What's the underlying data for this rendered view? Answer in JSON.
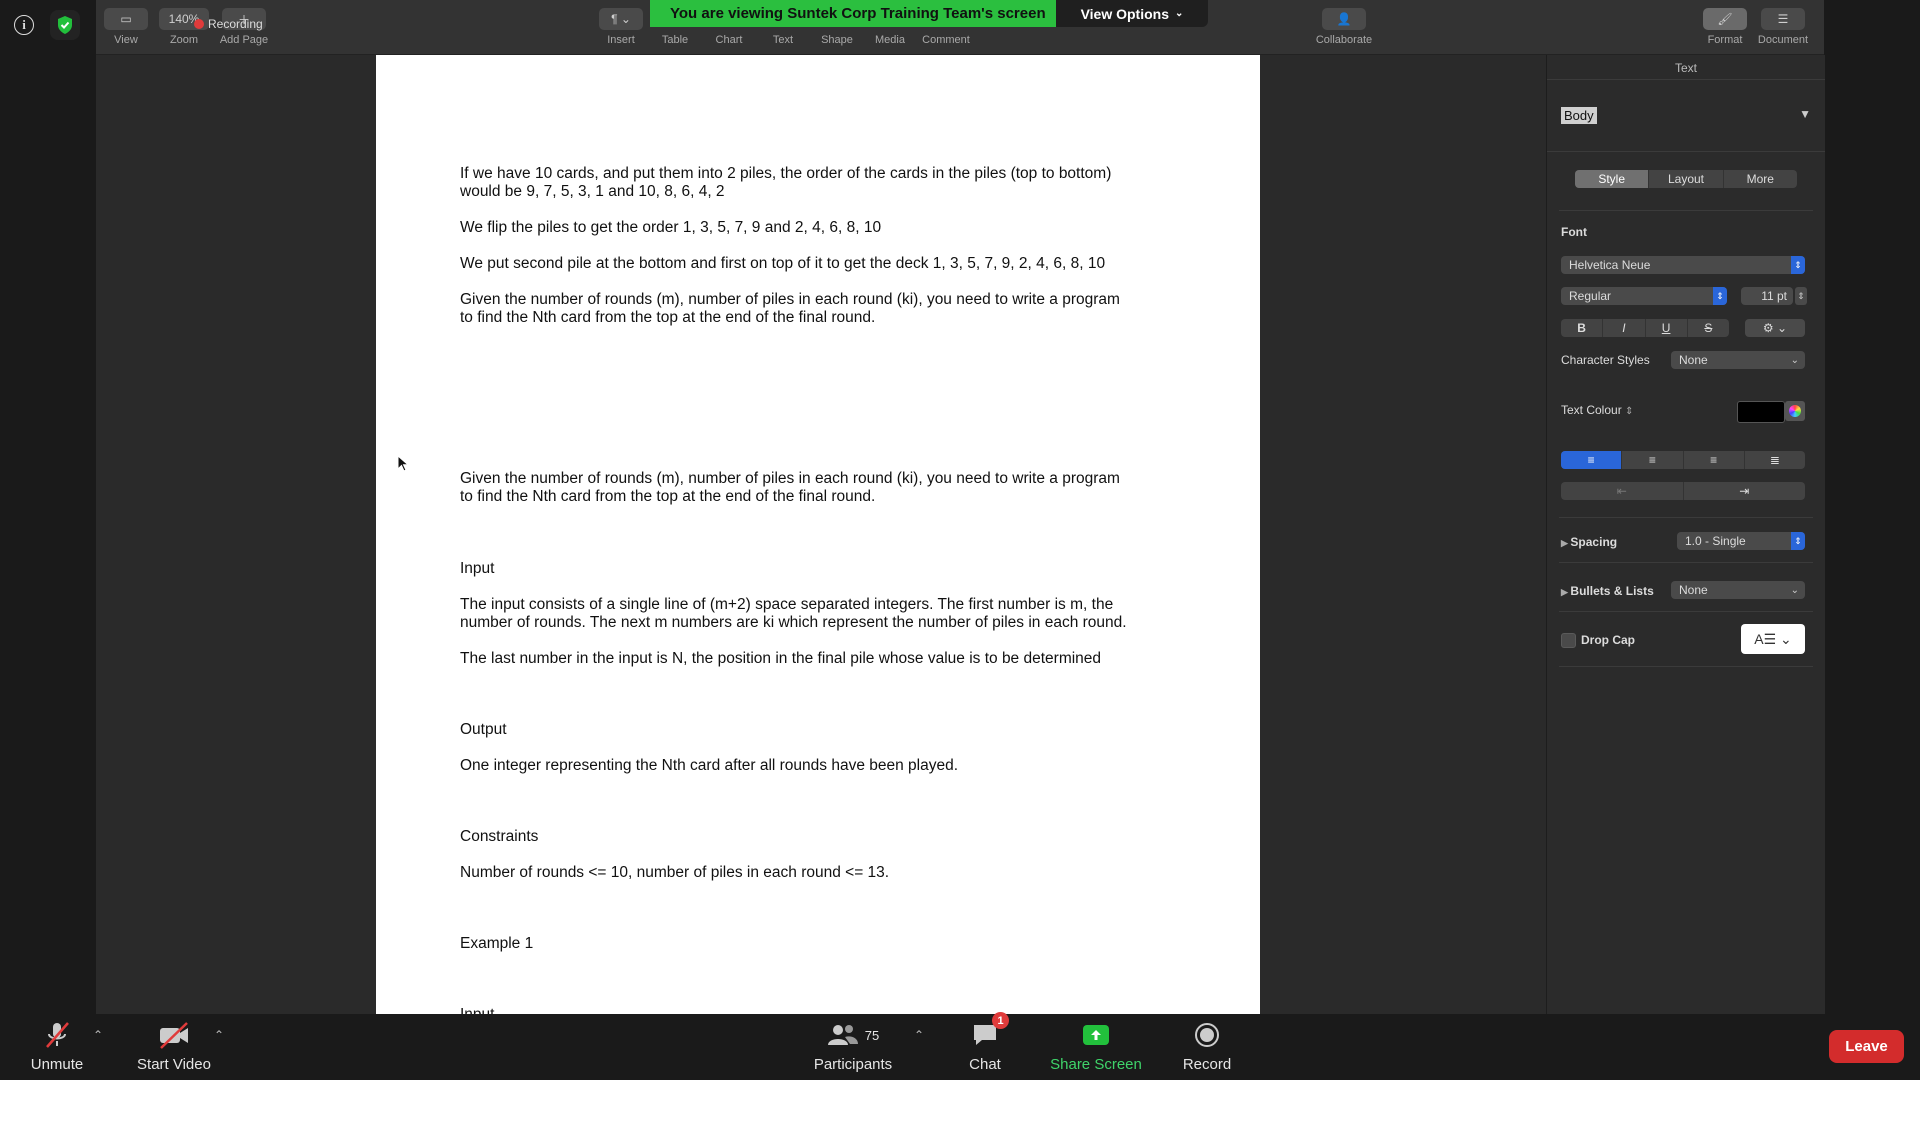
{
  "banner": {
    "viewing_text": "You are viewing Suntek Corp Training Team's screen",
    "view_options_label": "View Options"
  },
  "recording_label": "Recording",
  "pages_toolbar": {
    "zoom_value": "140%",
    "left_items": [
      "View",
      "Zoom",
      "Add Page"
    ],
    "insert_items": [
      "Insert",
      "Table",
      "Chart",
      "Text",
      "Shape",
      "Media",
      "Comment"
    ],
    "collaborate_label": "Collaborate",
    "right_items": [
      "Format",
      "Document"
    ]
  },
  "document": {
    "paragraphs": [
      "If we have 10 cards, and put them into 2 piles, the order of the cards in the piles (top to bottom)\nwould be 9, 7, 5, 3, 1 and 10, 8, 6, 4, 2",
      "We flip the piles to get the order 1, 3, 5, 7, 9 and 2, 4, 6, 8, 10",
      "We put second pile at the bottom and first on top of it to get the deck 1, 3, 5, 7, 9, 2, 4, 6, 8, 10",
      "Given the number of rounds (m), number of piles in each round (ki), you need to write a program\nto find the Nth card from the top at the end of the final round.",
      "Given the number of rounds (m), number of piles in each round (ki), you need to write a program\nto find the Nth card from the top at the end of the final round.",
      "Input",
      "The input consists of a single line of (m+2) space separated integers. The first number is m, the\nnumber of rounds. The next m numbers are ki which represent the number of piles in each round.",
      "The last number in the input is N, the position in the final pile whose value is to be determined",
      "Output",
      "One integer representing the Nth card after all rounds have been played.",
      "Constraints",
      "Number of rounds <= 10, number of piles in each round <= 13.",
      "Example 1",
      "Input"
    ]
  },
  "inspector": {
    "title": "Text",
    "paragraph_style": "Body",
    "tabs": [
      "Style",
      "Layout",
      "More"
    ],
    "font_label": "Font",
    "font_family": "Helvetica Neue",
    "font_weight": "Regular",
    "font_size": "11 pt",
    "format_buttons": [
      "B",
      "I",
      "U",
      "S"
    ],
    "character_styles_label": "Character Styles",
    "character_styles_value": "None",
    "text_colour_label": "Text Colour",
    "text_colour": "#000000",
    "spacing_label": "Spacing",
    "spacing_value": "1.0 - Single",
    "bullets_label": "Bullets & Lists",
    "bullets_value": "None",
    "drop_cap_label": "Drop Cap"
  },
  "zoom_controls": {
    "unmute_label": "Unmute",
    "start_video_label": "Start Video",
    "participants_label": "Participants",
    "participants_count": "75",
    "chat_label": "Chat",
    "chat_badge": "1",
    "share_screen_label": "Share Screen",
    "record_label": "Record",
    "leave_label": "Leave"
  },
  "colors": {
    "banner_green": "#2bbf3f",
    "leave_red": "#d32c2c",
    "share_green": "#22c03c",
    "align_active": "#2a66d9"
  }
}
